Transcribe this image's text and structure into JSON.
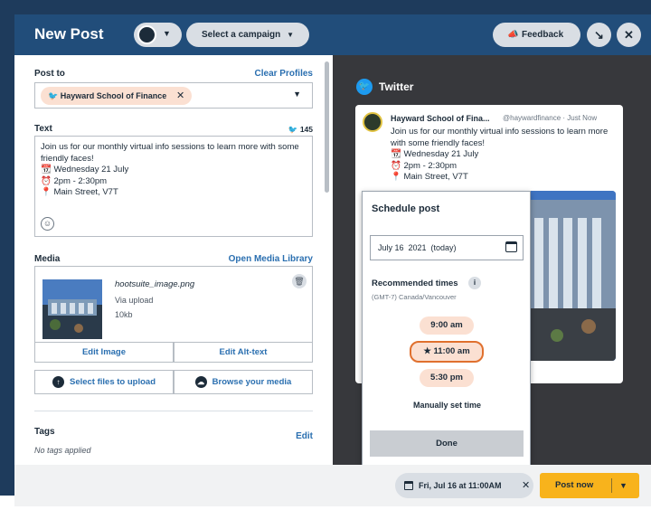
{
  "header": {
    "title": "New Post",
    "campaign_label": "Select a campaign",
    "feedback_label": "Feedback"
  },
  "post_to": {
    "label": "Post to",
    "clear_label": "Clear Profiles",
    "profile": "Hayward School of Finance"
  },
  "text_section": {
    "label": "Text",
    "char_count": "145",
    "body": "Join us for our monthly virtual info sessions to learn more with some friendly faces!\n📆 Wednesday 21 July\n⏰ 2pm - 2:30pm\n📍 Main Street, V7T"
  },
  "media": {
    "label": "Media",
    "library_link": "Open Media Library",
    "filename": "hootsuite_image.png",
    "source": "Via upload",
    "size": "10kb",
    "edit_image": "Edit Image",
    "edit_alt": "Edit Alt-text",
    "select_files": "Select files to upload",
    "browse": "Browse your media"
  },
  "tags": {
    "label": "Tags",
    "edit_label": "Edit",
    "empty_text": "No tags applied"
  },
  "preview": {
    "network": "Twitter",
    "author": "Hayward School of Fina...",
    "handle": "@haywardfinance · Just Now",
    "body": "Join us for our monthly virtual info sessions to learn more with some friendly faces!\n📆 Wednesday 21 July\n⏰ 2pm - 2:30pm\n📍 Main Street, V7T"
  },
  "schedule": {
    "title": "Schedule post",
    "date_value": "July 16  2021  (today)",
    "recommended_label": "Recommended times",
    "timezone": "(GMT-7) Canada/Vancouver",
    "times": [
      "9:00 am",
      "11:00 am",
      "5:30 pm"
    ],
    "selected_index": 1,
    "manual_label": "Manually set time",
    "done_label": "Done"
  },
  "footer": {
    "scheduled": "Fri, Jul 16 at 11:00AM",
    "post_now": "Post now"
  },
  "colors": {
    "header_bg": "#214d7a",
    "accent_link": "#2a6fb0",
    "chip_bg": "#fbe0d2",
    "selected_border": "#e0702e",
    "post_now_bg": "#f8b31c",
    "twitter_blue": "#1d9bf0"
  }
}
